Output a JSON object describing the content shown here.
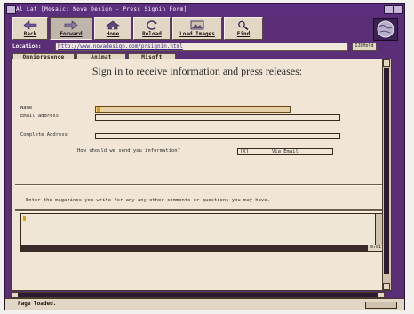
{
  "window": {
    "title": "Al Lat [Mosaic: Nova Design - Press Signin Form]"
  },
  "toolbar": {
    "buttons": [
      {
        "label": "Back",
        "icon": "back-arrow-icon"
      },
      {
        "label": "Forward",
        "icon": "forward-arrow-icon"
      },
      {
        "label": "Home",
        "icon": "home-icon"
      },
      {
        "label": "Reload",
        "icon": "reload-icon"
      },
      {
        "label": "Load Images",
        "icon": "load-images-icon"
      },
      {
        "label": "Find",
        "icon": "find-icon"
      }
    ]
  },
  "location": {
    "label": "Location:",
    "url": "http://www.novadesign.com/prsignin.html",
    "hold_label": "IJDHold"
  },
  "directory_buttons": [
    "Omnipresence",
    "Animat",
    "Misoft"
  ],
  "page": {
    "title": "Sign in to receive information and press releases:",
    "fields": {
      "name_label": "Name",
      "email_label": "Email address:",
      "address_label": "Complete Address",
      "send_question": "How should we send you information?",
      "send_option": "Via Email",
      "send_option_marker": "[X]"
    },
    "magazines_prompt": "Enter the magazines you write for any any other comments or questions you may have."
  },
  "textarea": {
    "indicator": "0:01"
  },
  "status": {
    "text": "Page loaded."
  },
  "colors": {
    "frame": "#5a2f78",
    "content_bg": "#f1e6d6",
    "button_bg": "#e2d6c4",
    "focus_yellow": "#d9a020"
  }
}
